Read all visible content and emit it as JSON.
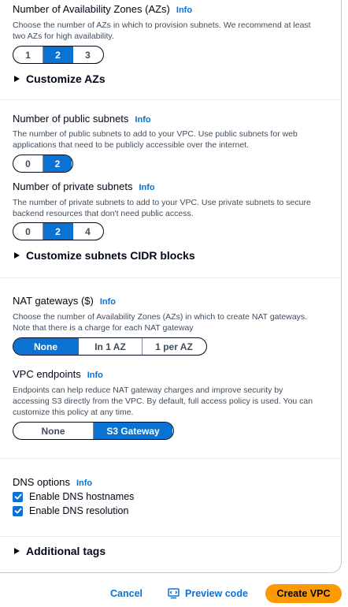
{
  "az": {
    "label": "Number of Availability Zones (AZs)",
    "info": "Info",
    "description": "Choose the number of AZs in which to provision subnets. We recommend at least two AZs for high availability.",
    "options": [
      "1",
      "2",
      "3"
    ],
    "selected": "2",
    "customize": "Customize AZs"
  },
  "public_subnets": {
    "label": "Number of public subnets",
    "info": "Info",
    "description": "The number of public subnets to add to your VPC. Use public subnets for web applications that need to be publicly accessible over the internet.",
    "options": [
      "0",
      "2"
    ],
    "selected": "2"
  },
  "private_subnets": {
    "label": "Number of private subnets",
    "info": "Info",
    "description": "The number of private subnets to add to your VPC. Use private subnets to secure backend resources that don't need public access.",
    "options": [
      "0",
      "2",
      "4"
    ],
    "selected": "2",
    "customize": "Customize subnets CIDR blocks"
  },
  "nat": {
    "label": "NAT gateways ($)",
    "info": "Info",
    "description": "Choose the number of Availability Zones (AZs) in which to create NAT gateways. Note that there is a charge for each NAT gateway",
    "options": [
      "None",
      "In 1 AZ",
      "1 per AZ"
    ],
    "selected": "None"
  },
  "endpoints": {
    "label": "VPC endpoints",
    "info": "Info",
    "description": "Endpoints can help reduce NAT gateway charges and improve security by accessing S3 directly from the VPC. By default, full access policy is used. You can customize this policy at any time.",
    "options": [
      "None",
      "S3 Gateway"
    ],
    "selected": "S3 Gateway"
  },
  "dns": {
    "label": "DNS options",
    "info": "Info",
    "hostnames": "Enable DNS hostnames",
    "resolution": "Enable DNS resolution",
    "hostnames_checked": true,
    "resolution_checked": true
  },
  "tags": {
    "label": "Additional tags"
  },
  "footer": {
    "cancel": "Cancel",
    "preview": "Preview code",
    "create": "Create VPC"
  },
  "colors": {
    "accent": "#0972d3",
    "primary": "#ff9900",
    "text": "#000716",
    "muted": "#414d5c"
  }
}
